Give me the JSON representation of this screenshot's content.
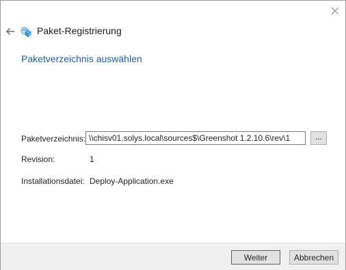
{
  "window": {
    "title": "Paket-Registrierung",
    "icons": {
      "back": "back-arrow-icon",
      "app": "package-icon",
      "close": "close-icon"
    }
  },
  "main": {
    "heading": "Paketverzeichnis auswählen",
    "fields": {
      "directory_label": "Paketverzeichnis:",
      "directory_value": "\\\\chisv01.solys.local\\sources$\\Greenshot 1.2.10.6\\rev\\1",
      "browse_label": "...",
      "revision_label": "Revision:",
      "revision_value": "1",
      "install_file_label": "Installationsdatei:",
      "install_file_value": "Deploy-Application.exe"
    }
  },
  "footer": {
    "next_label": "Weiter",
    "cancel_label": "Abbrechen"
  },
  "colors": {
    "heading": "#1f5fae",
    "footer_bg": "#f0f0f0",
    "button_bg": "#e1e1e1"
  }
}
